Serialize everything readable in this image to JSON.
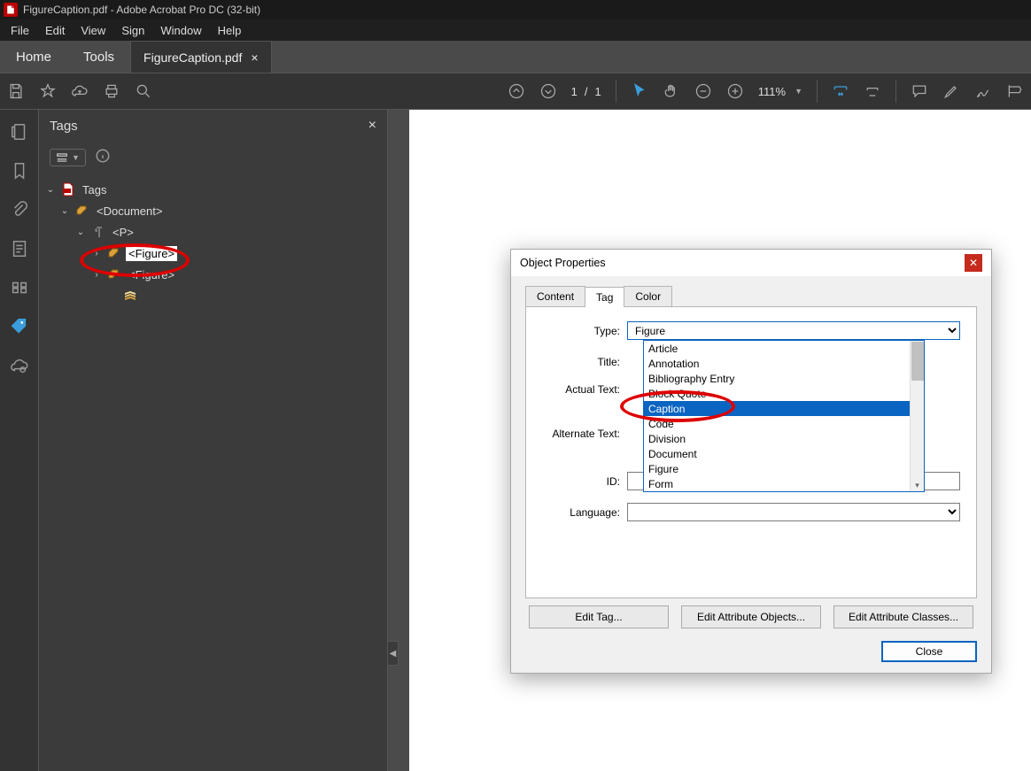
{
  "titlebar": {
    "text": "FigureCaption.pdf - Adobe Acrobat Pro DC (32-bit)"
  },
  "menubar": {
    "items": [
      "File",
      "Edit",
      "View",
      "Sign",
      "Window",
      "Help"
    ]
  },
  "tabs": {
    "home": "Home",
    "tools": "Tools",
    "doc": "FigureCaption.pdf"
  },
  "toolbar": {
    "page_current": "1",
    "page_sep": "/",
    "page_total": "1",
    "zoom": "111%"
  },
  "tagspanel": {
    "title": "Tags",
    "tree": {
      "root": "Tags",
      "doc": "<Document>",
      "p": "<P>",
      "figure1": "<Figure>",
      "figure2": "<Figure>"
    }
  },
  "dialog": {
    "title": "Object Properties",
    "tabs": {
      "content": "Content",
      "tag": "Tag",
      "color": "Color"
    },
    "labels": {
      "type": "Type:",
      "title": "Title:",
      "actual": "Actual Text:",
      "alternate": "Alternate Text:",
      "id": "ID:",
      "language": "Language:"
    },
    "type_value": "Figure",
    "dropdown_items": [
      "Article",
      "Annotation",
      "Bibliography Entry",
      "Block Quote",
      "Caption",
      "Code",
      "Division",
      "Document",
      "Figure",
      "Form"
    ],
    "dropdown_selected_index": 4,
    "buttons": {
      "edit_tag": "Edit Tag...",
      "edit_attr_obj": "Edit Attribute Objects...",
      "edit_attr_cls": "Edit Attribute Classes...",
      "close": "Close"
    }
  }
}
